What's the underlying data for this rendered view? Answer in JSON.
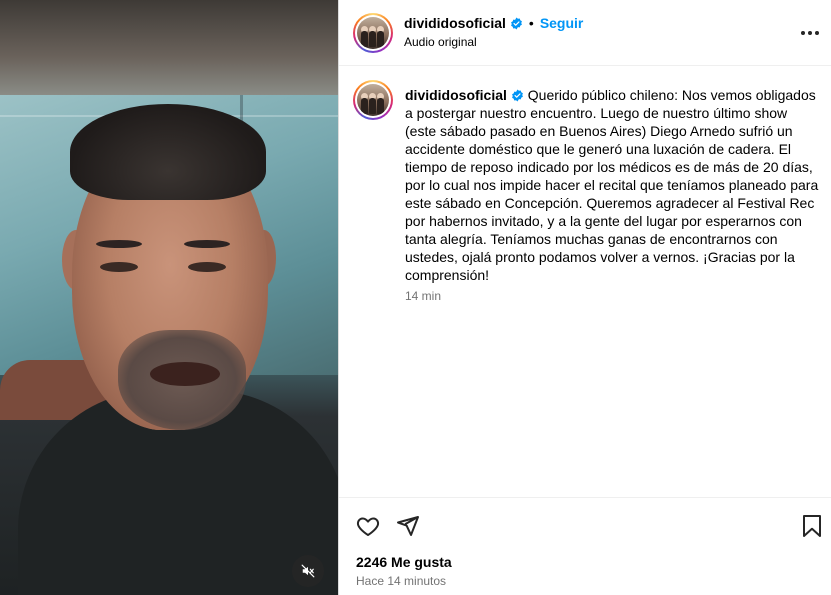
{
  "post": {
    "username": "divididosoficial",
    "separator": "•",
    "follow_label": "Seguir",
    "audio_label": "Audio original"
  },
  "caption": {
    "username": "divididosoficial",
    "text": "Querido público chileno: Nos vemos obligados a postergar nuestro encuentro. Luego de nuestro último show (este sábado pasado en Buenos Aires) Diego Arnedo sufrió un accidente doméstico que le generó una luxación de cadera. El tiempo de reposo indicado por los médicos es de más de 20 días, por lo cual nos impide hacer el recital que teníamos planeado para este sábado en Concepción. Queremos agradecer al Festival Rec por habernos invitado, y a la gente del lugar por esperarnos con tanta alegría. Teníamos muchas ganas de encontrarnos con ustedes, ojalá pronto podamos volver a vernos. ¡Gracias por la comprensión!",
    "time": "14 min"
  },
  "engagement": {
    "likes": "2246 Me gusta",
    "posted_ago": "Hace 14 minutos"
  },
  "icons": {
    "verified": "verified-badge-icon",
    "more": "more-options-icon",
    "like": "heart-icon",
    "share": "send-icon",
    "save": "bookmark-icon",
    "mute": "muted-speaker-icon"
  },
  "colors": {
    "link": "#0095f6",
    "verified": "#0095f6",
    "secondary_text": "#737373"
  }
}
